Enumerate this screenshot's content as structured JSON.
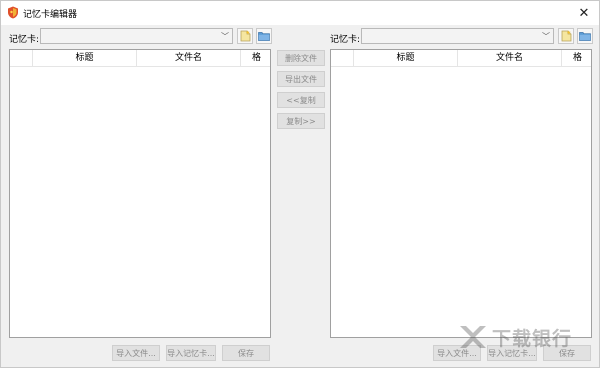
{
  "window": {
    "title": "记忆卡编辑器",
    "close_glyph": "✕"
  },
  "left_panel": {
    "label": "记忆卡:",
    "selected_value": "",
    "new_icon": "new-file-icon",
    "open_icon": "folder-icon",
    "columns": [
      "",
      "标题",
      "文件名",
      "格"
    ],
    "buttons": {
      "import_file": "导入文件...",
      "import_card": "导入记忆卡...",
      "save": "保存"
    }
  },
  "middle_buttons": {
    "delete_file": "删除文件",
    "export_file": "导出文件",
    "copy_left": "<<复制",
    "copy_right": "复制>>"
  },
  "right_panel": {
    "label": "记忆卡:",
    "selected_value": "",
    "new_icon": "new-file-icon",
    "open_icon": "folder-icon",
    "columns": [
      "",
      "标题",
      "文件名",
      "格"
    ],
    "buttons": {
      "import_file": "导入文件...",
      "import_card": "导入记忆卡...",
      "save": "保存"
    }
  },
  "watermark": {
    "text": "下载银行"
  },
  "colors": {
    "window_bg": "#f0f0f0",
    "icon_yellow": "#f5e6a0",
    "folder_blue": "#5b9bd5",
    "title_icon_red": "#e0502a"
  }
}
